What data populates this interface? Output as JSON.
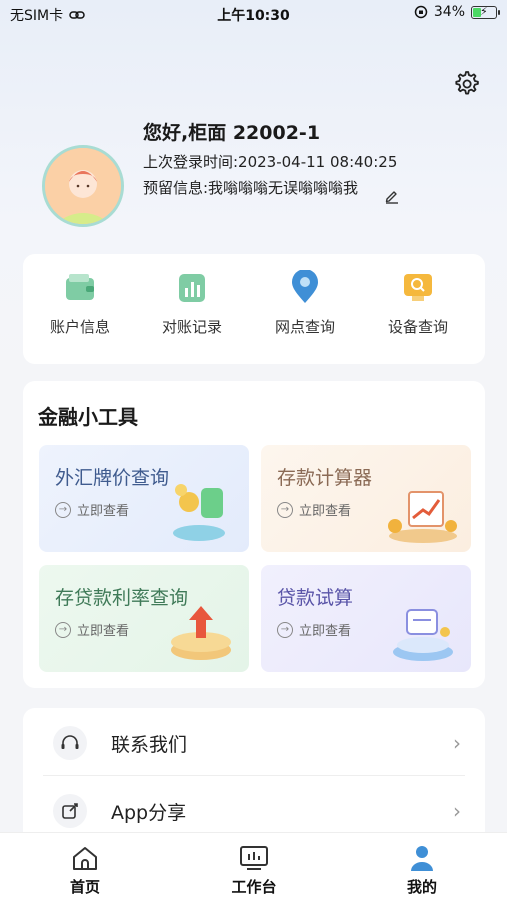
{
  "status": {
    "carrier": "无SIM卡",
    "time": "上午10:30",
    "battery": "34%",
    "battery_level": 0.34
  },
  "profile": {
    "greeting": "您好,柜面 22002-1",
    "last_login": "上次登录时间:2023-04-11 08:40:25",
    "reserved_info": "预留信息:我嗡嗡嗡无误嗡嗡嗡我"
  },
  "quick_actions": [
    {
      "label": "账户信息",
      "icon": "wallet-icon"
    },
    {
      "label": "对账记录",
      "icon": "bar-chart-icon"
    },
    {
      "label": "网点查询",
      "icon": "location-pin-icon"
    },
    {
      "label": "设备查询",
      "icon": "monitor-search-icon"
    }
  ],
  "tools": {
    "title": "金融小工具",
    "view_label": "立即查看",
    "items": [
      {
        "title": "外汇牌价查询",
        "color": "#3f5b8e"
      },
      {
        "title": "存款计算器",
        "color": "#8a6a55"
      },
      {
        "title": "存贷款利率查询",
        "color": "#3f7a58"
      },
      {
        "title": "贷款试算",
        "color": "#5a55a8"
      }
    ]
  },
  "menu": [
    {
      "label": "联系我们",
      "icon": "headset-icon"
    },
    {
      "label": "App分享",
      "icon": "share-icon"
    }
  ],
  "tabbar": [
    {
      "label": "首页",
      "icon": "home-icon"
    },
    {
      "label": "工作台",
      "icon": "workbench-icon"
    },
    {
      "label": "我的",
      "icon": "user-icon"
    }
  ],
  "colors": {
    "accent": "#3f8fd6",
    "avatar_border": "#a8dcd3"
  }
}
